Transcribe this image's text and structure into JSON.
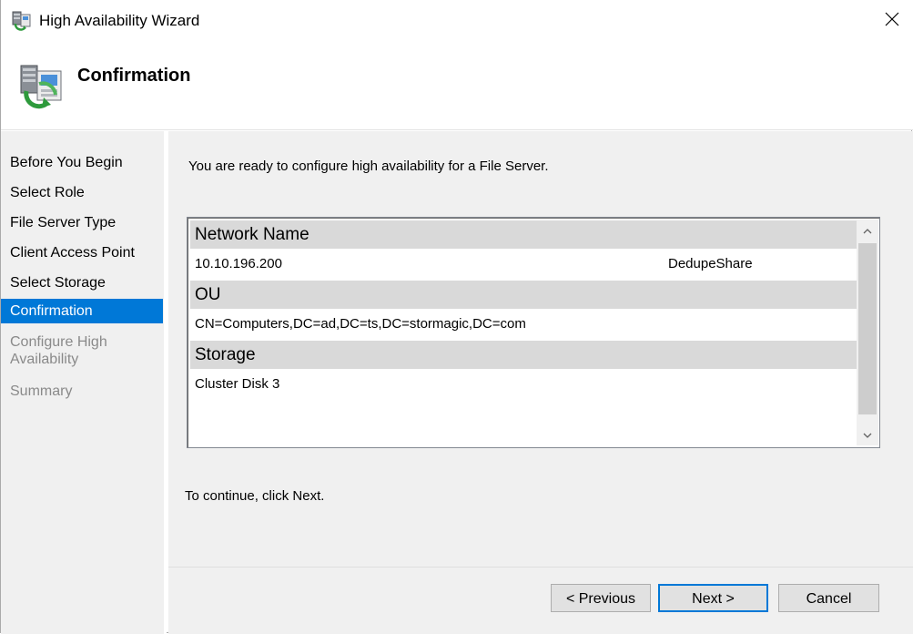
{
  "window": {
    "title": "High Availability Wizard"
  },
  "header": {
    "title": "Confirmation"
  },
  "steps": [
    {
      "label": "Before You Begin",
      "state": "done"
    },
    {
      "label": "Select Role",
      "state": "done"
    },
    {
      "label": "File Server Type",
      "state": "done"
    },
    {
      "label": "Client Access Point",
      "state": "done"
    },
    {
      "label": "Select Storage",
      "state": "done"
    },
    {
      "label": "Confirmation",
      "state": "active"
    },
    {
      "label": "Configure High Availability",
      "state": "pending"
    },
    {
      "label": "Summary",
      "state": "pending"
    }
  ],
  "main": {
    "intro": "You are ready to configure high availability for a File Server.",
    "groups": [
      {
        "header": "Network Name",
        "value": "10.10.196.200",
        "value2": "DedupeShare"
      },
      {
        "header": "OU",
        "value": "CN=Computers,DC=ad,DC=ts,DC=stormagic,DC=com"
      },
      {
        "header": "Storage",
        "value": "Cluster Disk 3"
      }
    ],
    "continue_text": "To continue, click Next."
  },
  "buttons": {
    "previous": "< Previous",
    "next": "Next >",
    "cancel": "Cancel"
  },
  "colors": {
    "accent": "#0078d7",
    "panel_bg": "#f0f0f0",
    "group_header_bg": "#d9d9d9",
    "pending_text": "#8a8a8a"
  },
  "icons": {
    "app": "cluster-server-icon",
    "header": "cluster-server-icon",
    "close": "close-icon",
    "scroll_up": "chevron-up-icon",
    "scroll_down": "chevron-down-icon"
  }
}
